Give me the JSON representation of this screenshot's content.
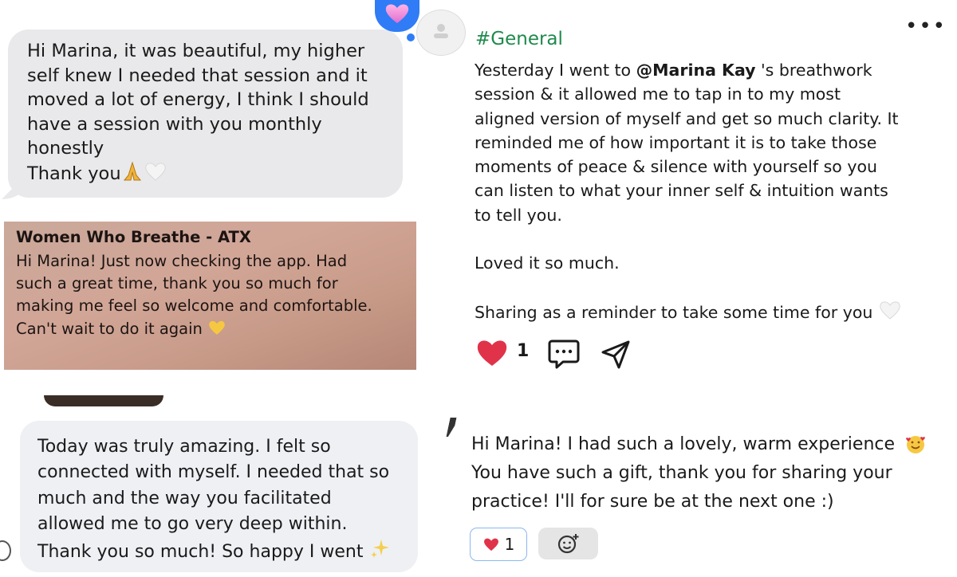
{
  "bubble_one": {
    "text": "Hi Marina, it was beautiful, my higher\nself knew I needed that session and it\nmoved a lot of energy, I think I should\nhave a session with you monthly\nhonestly\nThank you",
    "reaction_icon": "heart-icon"
  },
  "notification": {
    "title": "Women Who Breathe - ATX",
    "body": "Hi Marina! Just now checking the app. Had\nsuch a great time, thank you so much for\nmaking me feel so welcome and comfortable.\nCan't wait to do it again"
  },
  "bubble_three": {
    "text": "Today was truly amazing. I felt so\nconnected with myself. I needed that so\nmuch and the way you facilitated\nallowed me to go very deep within.\nThank you so much! So happy I went"
  },
  "post": {
    "channel": "#General",
    "text_before": "Yesterday I went to ",
    "mention": "@Marina Kay",
    "text_after": " 's breathwork\nsession & it allowed me to tap in to my most\naligned version of myself and get so much clarity. It\nreminded me of how important it is to take those\nmoments of peace & silence with yourself so you\ncan listen to what your inner self & intuition wants\nto tell you.\n\nLoved it so much.\n\nSharing as a reminder to take some time for you",
    "like_count": "1",
    "more_label": "•••"
  },
  "message_four": {
    "text": "Hi Marina! I had such a lovely, warm experience \nYou have such a gift, thank you for sharing your\npractice! I'll for sure be at the next one :)",
    "reaction_count": "1"
  },
  "colors": {
    "channel_green": "#1f8a4c",
    "heart_red": "#e0334a",
    "imessage_blue": "#2f7cf6"
  }
}
